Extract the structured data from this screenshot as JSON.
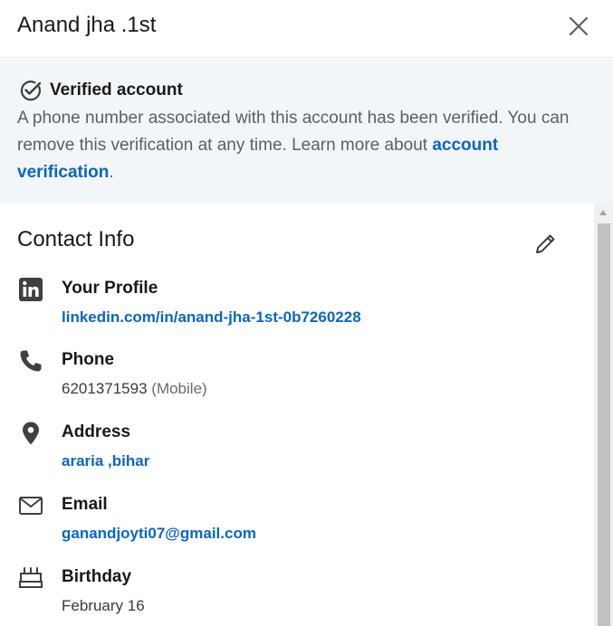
{
  "header": {
    "title": "Anand jha .1st",
    "close_icon": "close-icon"
  },
  "verified": {
    "title": "Verified account",
    "text": "A phone number associated with this account has been verified. You can remove this verification at any time. Learn more about ",
    "link": "account verification",
    "suffix": ".",
    "icon": "check-circle-icon"
  },
  "contact": {
    "title": "Contact Info",
    "edit_icon": "pencil-icon",
    "items": [
      {
        "label": "Your Profile",
        "value": "linkedin.com/in/anand-jha-1st-0b7260228",
        "icon": "linkedin-icon"
      },
      {
        "label": "Phone",
        "value": "6201371593",
        "note": "(Mobile)",
        "icon": "phone-icon"
      },
      {
        "label": "Address",
        "value": "araria ,bihar",
        "icon": "location-pin-icon"
      },
      {
        "label": "Email",
        "value": "ganandjoyti07@gmail.com",
        "icon": "envelope-icon"
      },
      {
        "label": "Birthday",
        "value": "February 16",
        "icon": "cake-icon"
      }
    ]
  },
  "colors": {
    "link": "#0a66c2",
    "banner_bg": "#f3f6f8",
    "text": "#191919"
  }
}
